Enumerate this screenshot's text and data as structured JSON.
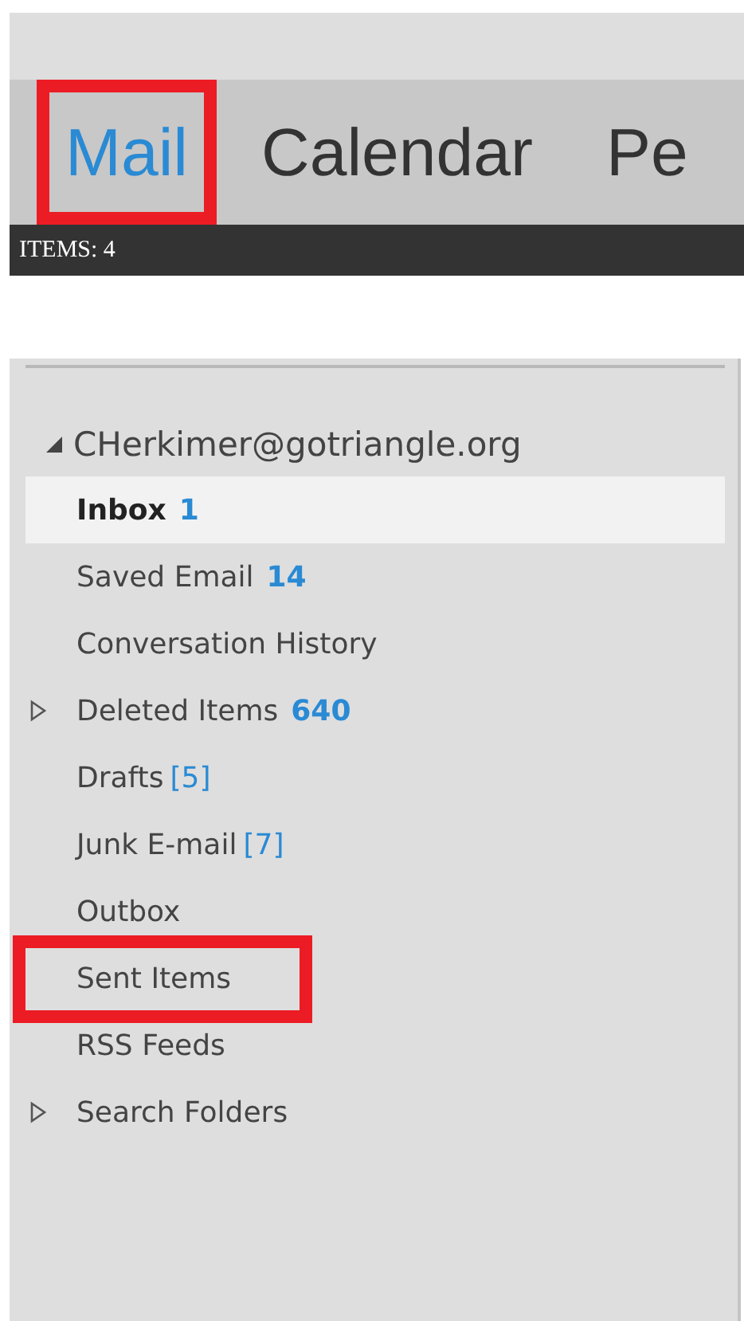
{
  "nav_tabs": [
    {
      "label": "Mail",
      "selected": true,
      "highlighted": true
    },
    {
      "label": "Calendar",
      "selected": false,
      "highlighted": false
    },
    {
      "label": "Pe",
      "selected": false,
      "highlighted": false
    }
  ],
  "status_bar": {
    "items_count": "ITEMS: 4"
  },
  "folder_pane": {
    "account": {
      "label": "CHerkimer@gotriangle.org",
      "expanded": true
    },
    "folders": [
      {
        "name": "Inbox",
        "count": "1",
        "count_bold": true,
        "bold": true,
        "selected": true,
        "expandable": false,
        "highlighted": false
      },
      {
        "name": "Saved Email",
        "count": "14",
        "count_bold": true,
        "bold": false,
        "selected": false,
        "expandable": false,
        "highlighted": false
      },
      {
        "name": "Conversation History",
        "bold": false,
        "selected": false,
        "expandable": false,
        "highlighted": false
      },
      {
        "name": "Deleted Items",
        "count": "640",
        "count_bold": true,
        "bold": false,
        "selected": false,
        "expandable": true,
        "highlighted": false
      },
      {
        "name": "Drafts",
        "count": "[5]",
        "count_bold": false,
        "bold": false,
        "selected": false,
        "expandable": false,
        "highlighted": false
      },
      {
        "name": "Junk E-mail",
        "count": "[7]",
        "count_bold": false,
        "bold": false,
        "selected": false,
        "expandable": false,
        "highlighted": false
      },
      {
        "name": "Outbox",
        "bold": false,
        "selected": false,
        "expandable": false,
        "highlighted": false
      },
      {
        "name": "Sent Items",
        "bold": false,
        "selected": false,
        "expandable": false,
        "highlighted": true
      },
      {
        "name": "RSS Feeds",
        "bold": false,
        "selected": false,
        "expandable": false,
        "highlighted": false
      },
      {
        "name": "Search Folders",
        "bold": false,
        "selected": false,
        "expandable": true,
        "highlighted": false
      }
    ]
  }
}
